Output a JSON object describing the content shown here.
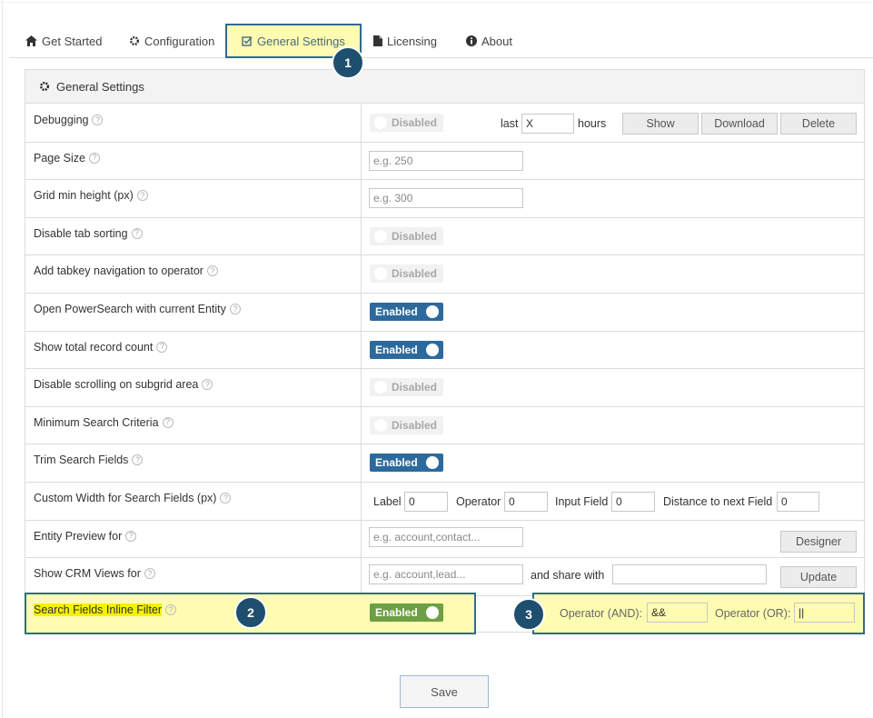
{
  "tabs": [
    {
      "label": "Get Started",
      "icon": "home-icon"
    },
    {
      "label": "Configuration",
      "icon": "gear-icon"
    },
    {
      "label": "General Settings",
      "icon": "edit-check-icon"
    },
    {
      "label": "Licensing",
      "icon": "document-icon"
    },
    {
      "label": "About",
      "icon": "info-icon"
    }
  ],
  "panel": {
    "title": "General Settings"
  },
  "badges": [
    "1",
    "2",
    "3"
  ],
  "rows": {
    "debugging": {
      "label": "Debugging",
      "toggle": "Disabled",
      "last_label": "last",
      "last_value": "X",
      "hours_label": "hours",
      "show": "Show",
      "download": "Download",
      "delete": "Delete"
    },
    "page_size": {
      "label": "Page Size",
      "placeholder": "e.g. 250"
    },
    "grid_min_height": {
      "label": "Grid min height (px)",
      "placeholder": "e.g. 300"
    },
    "disable_tab_sorting": {
      "label": "Disable tab sorting",
      "toggle": "Disabled"
    },
    "tabkey_navigation": {
      "label": "Add tabkey navigation to operator",
      "toggle": "Disabled"
    },
    "open_powersearch": {
      "label": "Open PowerSearch with current Entity",
      "toggle": "Enabled"
    },
    "total_record_count": {
      "label": "Show total record count",
      "toggle": "Enabled"
    },
    "disable_scrolling": {
      "label": "Disable scrolling on subgrid area",
      "toggle": "Disabled"
    },
    "min_search_criteria": {
      "label": "Minimum Search Criteria",
      "toggle": "Disabled"
    },
    "trim_search_fields": {
      "label": "Trim Search Fields",
      "toggle": "Enabled"
    },
    "custom_width": {
      "label": "Custom Width for Search Fields (px)",
      "label_label": "Label",
      "label_value": "0",
      "operator_label": "Operator",
      "operator_value": "0",
      "input_label": "Input Field",
      "input_value": "0",
      "distance_label": "Distance to next Field",
      "distance_value": "0"
    },
    "entity_preview": {
      "label": "Entity Preview for",
      "placeholder": "e.g. account,contact...",
      "designer": "Designer"
    },
    "crm_views": {
      "label": "Show CRM Views for",
      "placeholder": "e.g. account,lead...",
      "share_label": "and share with",
      "update": "Update"
    },
    "inline_filter": {
      "label": "Search Fields Inline Filter",
      "toggle": "Enabled",
      "and_label": "Operator (AND):",
      "and_value": "&&",
      "or_label": "Operator (OR):",
      "or_value": "||"
    }
  },
  "save_label": "Save",
  "colors": {
    "accent": "#2c6a9d",
    "highlight": "#fdfcb0",
    "badge": "#1e4f6e",
    "enabled_green": "#6e9f46"
  }
}
